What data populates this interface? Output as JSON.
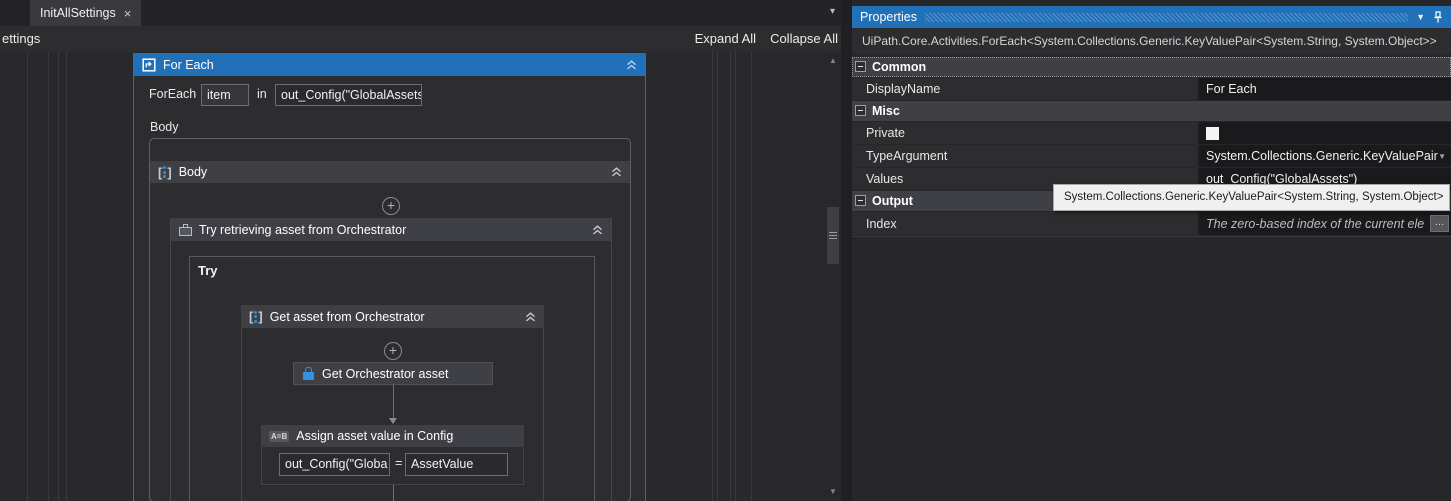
{
  "tab": {
    "title": "InitAllSettings",
    "close": "×",
    "overflow_arrow": "▾"
  },
  "toolbar": {
    "breadcrumb": "ettings",
    "expand_all": "Expand All",
    "collapse_all": "Collapse All"
  },
  "designer": {
    "for_each": {
      "title": "For Each",
      "foreach_label": "ForEach",
      "item_value": "item",
      "in_label": "in",
      "collection_value": "out_Config(\"GlobalAssets\"",
      "body_label": "Body"
    },
    "body_sequence": {
      "title": "Body"
    },
    "try_catch": {
      "title": "Try retrieving asset from Orchestrator",
      "try_label": "Try"
    },
    "inner_sequence": {
      "title": "Get asset from Orchestrator"
    },
    "get_asset": {
      "title": "Get Orchestrator asset"
    },
    "assign": {
      "title": "Assign asset value in Config",
      "icon_text": "A=B",
      "to_value": "out_Config(\"Globa",
      "equals": "=",
      "value": "AssetValue"
    }
  },
  "properties": {
    "title": "Properties",
    "type_signature": "UiPath.Core.Activities.ForEach<System.Collections.Generic.KeyValuePair<System.String, System.Object>>",
    "sections": {
      "common": "Common",
      "misc": "Misc",
      "output": "Output"
    },
    "rows": {
      "display_name": {
        "label": "DisplayName",
        "value": "For Each"
      },
      "private": {
        "label": "Private"
      },
      "type_argument": {
        "label": "TypeArgument",
        "value": "System.Collections.Generic.KeyValuePair"
      },
      "values": {
        "label": "Values",
        "value": "out_Config(\"GlobalAssets\")"
      },
      "index": {
        "label": "Index",
        "placeholder": "The zero-based index of the current ele",
        "button": "…"
      }
    },
    "tooltip": "System.Collections.Generic.KeyValuePair<System.String, System.Object>"
  },
  "colors": {
    "accent_blue": "#2171b9",
    "sequence_dot_blue": "#2f8fd6",
    "lock_blue": "#3095e0"
  }
}
